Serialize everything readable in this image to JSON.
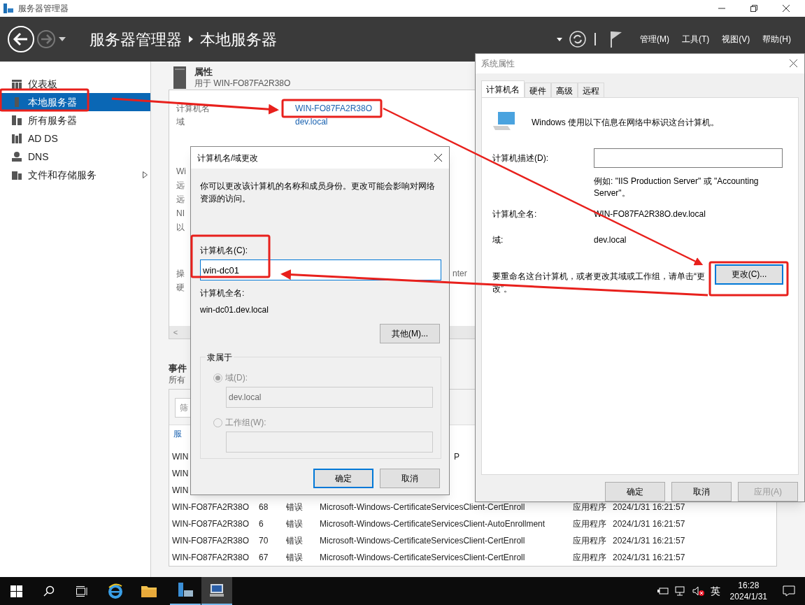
{
  "window": {
    "title": "服务器管理器"
  },
  "header": {
    "breadcrumb": [
      "服务器管理器",
      "本地服务器"
    ],
    "menus": [
      "管理(M)",
      "工具(T)",
      "视图(V)",
      "帮助(H)"
    ]
  },
  "sidebar": {
    "items": [
      {
        "label": "仪表板",
        "selected": false,
        "expandable": false
      },
      {
        "label": "本地服务器",
        "selected": true,
        "expandable": false
      },
      {
        "label": "所有服务器",
        "selected": false,
        "expandable": false
      },
      {
        "label": "AD DS",
        "selected": false,
        "expandable": false
      },
      {
        "label": "DNS",
        "selected": false,
        "expandable": false
      },
      {
        "label": "文件和存储服务",
        "selected": false,
        "expandable": true
      }
    ]
  },
  "properties": {
    "title": "属性",
    "subtitle": "用于 WIN-FO87FA2R38O",
    "fields": [
      {
        "label": "计算机名",
        "value": "WIN-FO87FA2R38O"
      },
      {
        "label": "域",
        "value": "dev.local"
      }
    ],
    "covered_labels": [
      "Wi",
      "远",
      "远",
      "NI",
      "以"
    ],
    "covered_labels_2": [
      "操",
      "硬"
    ],
    "covered_value": "nter",
    "scroll_left": "<"
  },
  "events": {
    "title": "事件",
    "subtitle": "所有",
    "filter_placeholder": "筛",
    "group_label": "服",
    "rows": [
      {
        "cells": [
          "WIN"
        ],
        "tail": "P"
      },
      {
        "cells": [
          "WIN"
        ]
      },
      {
        "cells": [
          "WIN"
        ]
      },
      {
        "cells": [
          "WIN-FO87FA2R38O",
          "68",
          "错误",
          "Microsoft-Windows-CertificateServicesClient-CertEnroll",
          "应用程序",
          "2024/1/31 16:21:57"
        ]
      },
      {
        "cells": [
          "WIN-FO87FA2R38O",
          "6",
          "错误",
          "Microsoft-Windows-CertificateServicesClient-AutoEnrollment",
          "应用程序",
          "2024/1/31 16:21:57"
        ]
      },
      {
        "cells": [
          "WIN-FO87FA2R38O",
          "70",
          "错误",
          "Microsoft-Windows-CertificateServicesClient-CertEnroll",
          "应用程序",
          "2024/1/31 16:21:57"
        ]
      },
      {
        "cells": [
          "WIN-FO87FA2R38O",
          "67",
          "错误",
          "Microsoft-Windows-CertificateServicesClient-CertEnroll",
          "应用程序",
          "2024/1/31 16:21:57"
        ]
      }
    ]
  },
  "change_dialog": {
    "title": "计算机名/域更改",
    "intro": "你可以更改该计算机的名称和成员身份。更改可能会影响对网络资源的访问。",
    "name_label": "计算机名(C):",
    "name_value": "win-dc01",
    "full_name_label": "计算机全名:",
    "full_name": "win-dc01.dev.local",
    "more_button": "其他(M)...",
    "member_of": {
      "title": "隶属于",
      "options": [
        {
          "label": "域(D):",
          "selected": true,
          "disabled": true,
          "value": "dev.local"
        },
        {
          "label": "工作组(W):",
          "selected": false,
          "disabled": true
        }
      ]
    },
    "buttons": [
      {
        "label": "确定",
        "default": true
      },
      {
        "label": "取消",
        "default": false
      }
    ]
  },
  "system_dialog": {
    "title": "系统属性",
    "tabs": [
      {
        "label": "计算机名",
        "selected": true
      },
      {
        "label": "硬件",
        "selected": false
      },
      {
        "label": "高级",
        "selected": false
      },
      {
        "label": "远程",
        "selected": false
      }
    ],
    "intro": "Windows 使用以下信息在网络中标识这台计算机。",
    "description_label": "计算机描述(D):",
    "example": "例如: \"IIS Production Server\" 或 \"Accounting Server\"。",
    "full_name_label": "计算机全名:",
    "full_name": "WIN-FO87FA2R38O.dev.local",
    "domain_label": "域:",
    "domain": "dev.local",
    "rename_text": "要重命名这台计算机，或者更改其域或工作组，请单击“更改”。",
    "change_button": "更改(C)...",
    "buttons": [
      {
        "label": "确定",
        "disabled": false
      },
      {
        "label": "取消",
        "disabled": false
      },
      {
        "label": "应用(A)",
        "disabled": true
      }
    ]
  },
  "taskbar": {
    "ime": "英",
    "time": "16:28",
    "date": "2024/1/31"
  }
}
